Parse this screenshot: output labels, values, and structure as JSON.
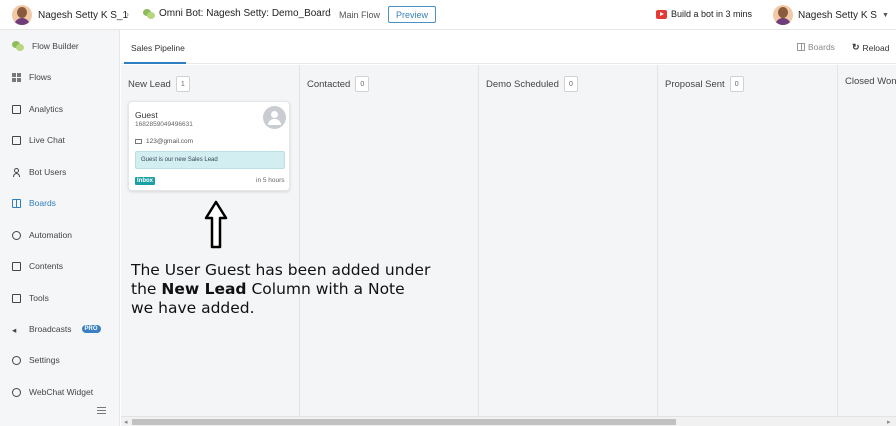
{
  "topbar": {
    "user_name": "Nagesh Setty K S_1",
    "bot_name": "Omni Bot: Nagesh Setty: Demo_Board",
    "flow_name": "Main Flow",
    "preview_label": "Preview",
    "build_link": "Build a bot in 3 mins",
    "profile_name": "Nagesh Setty K S"
  },
  "sidebar": {
    "items": [
      {
        "label": "Flow Builder",
        "icon": "chat-bubbles-icon"
      },
      {
        "label": "Flows",
        "icon": "grid-icon"
      },
      {
        "label": "Analytics",
        "icon": "analytics-icon"
      },
      {
        "label": "Live Chat",
        "icon": "live-chat-icon"
      },
      {
        "label": "Bot Users",
        "icon": "user-icon"
      },
      {
        "label": "Boards",
        "icon": "board-icon",
        "active": true
      },
      {
        "label": "Automation",
        "icon": "automation-icon"
      },
      {
        "label": "Contents",
        "icon": "contents-icon"
      },
      {
        "label": "Tools",
        "icon": "tools-icon"
      },
      {
        "label": "Broadcasts",
        "icon": "broadcast-icon",
        "badge": "PRO"
      },
      {
        "label": "Settings",
        "icon": "settings-icon"
      },
      {
        "label": "WebChat Widget",
        "icon": "webchat-icon"
      }
    ]
  },
  "subbar": {
    "tab": "Sales Pipeline",
    "boards_label": "Boards",
    "reload_label": "Reload"
  },
  "columns": [
    {
      "title": "New Lead",
      "count": "1"
    },
    {
      "title": "Contacted",
      "count": "0"
    },
    {
      "title": "Demo Scheduled",
      "count": "0"
    },
    {
      "title": "Proposal Sent",
      "count": "0"
    },
    {
      "title": "Closed Won",
      "count": ""
    }
  ],
  "card": {
    "name": "Guest",
    "id": "1682859049496631",
    "email": "123@gmail.com",
    "note": "Guest is our new Sales Lead",
    "channel": "Inbox",
    "time": "in 5 hours"
  },
  "annotation": {
    "part1": "The User Guest has been added under the ",
    "bold": "New Lead",
    "part2": " Column with a Note we have added."
  },
  "colors": {
    "accent": "#2f7ec0",
    "channel_badge": "#1aa0a6",
    "note_bg": "#d3eef1"
  }
}
